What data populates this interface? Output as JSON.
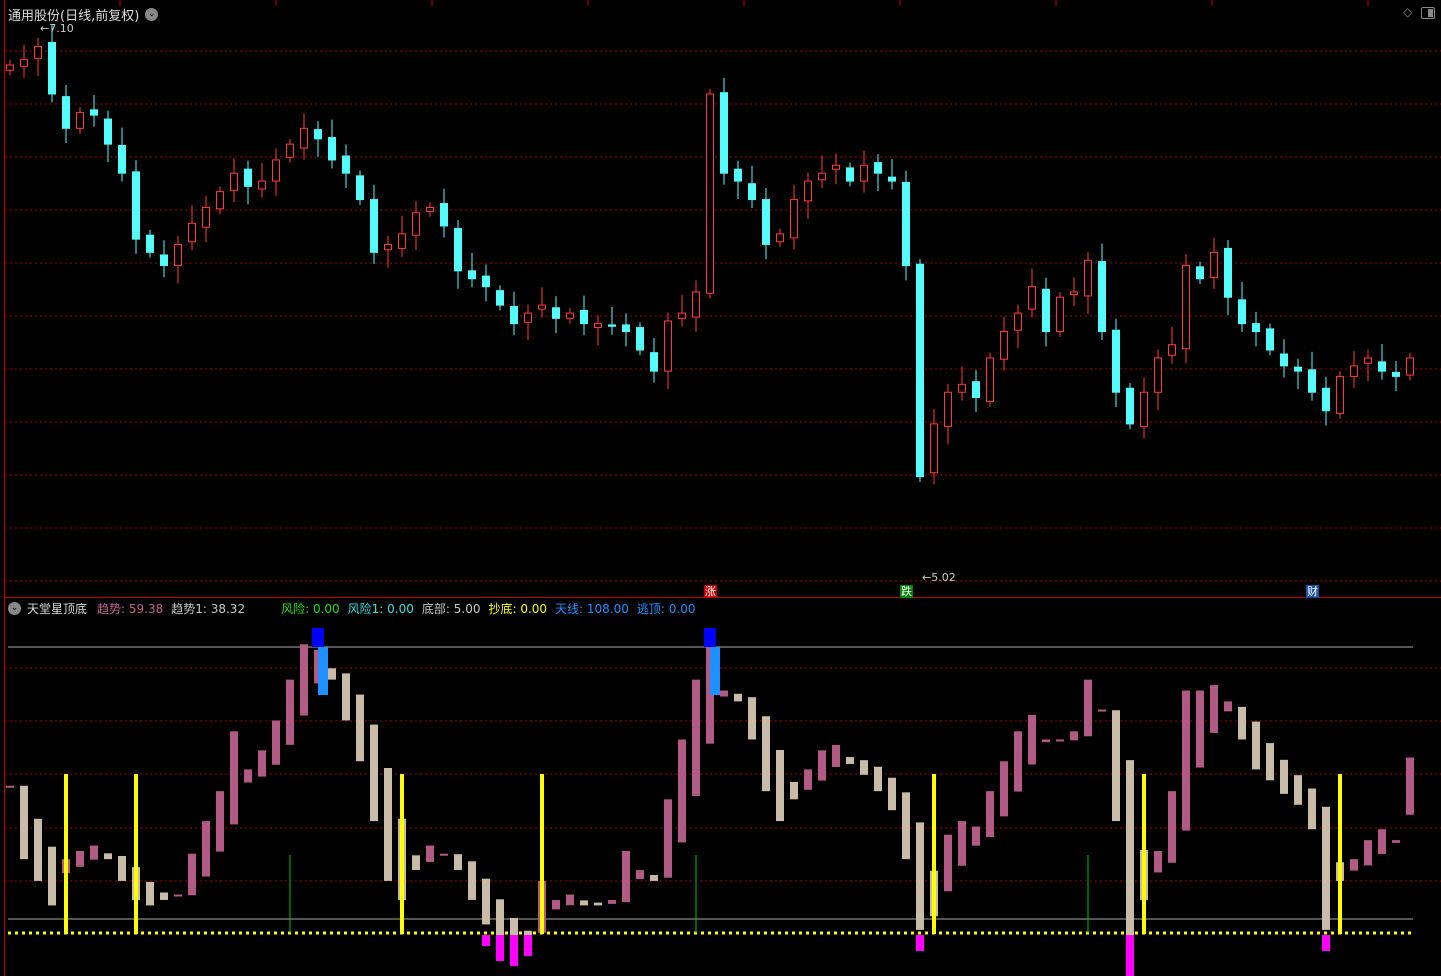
{
  "header": {
    "title": "通用股份(日线,前复权)",
    "high_label": "7.10",
    "low_label": "5.02"
  },
  "price_scale": {
    "max": 7.1,
    "min": 5.02
  },
  "colors": {
    "up": "#ff3b3b",
    "down": "#54fcfc",
    "grid": "#a00000",
    "trend_up": "#b05a84",
    "trend_down": "#c8bca8",
    "buy": "#ffff00",
    "escape": "#1e90ff",
    "top": "#0000ff",
    "risk": "#ff00ff",
    "signal": "#00c000"
  },
  "markers": [
    {
      "label": "涨",
      "index": 50,
      "color": "#c00000"
    },
    {
      "label": "跌",
      "index": 64,
      "color": "#008000"
    },
    {
      "label": "财",
      "index": 93,
      "color": "#2050a0"
    }
  ],
  "closes": [
    6.96,
    6.98,
    7.03,
    6.85,
    6.72,
    6.78,
    6.77,
    6.66,
    6.55,
    6.3,
    6.25,
    6.2,
    6.28,
    6.36,
    6.42,
    6.48,
    6.55,
    6.5,
    6.52,
    6.6,
    6.66,
    6.72,
    6.68,
    6.6,
    6.55,
    6.45,
    6.25,
    6.28,
    6.32,
    6.4,
    6.42,
    6.35,
    6.18,
    6.15,
    6.12,
    6.05,
    5.98,
    6.02,
    6.05,
    6.0,
    6.02,
    5.98,
    5.98,
    5.97,
    5.95,
    5.88,
    5.8,
    5.99,
    6.02,
    6.1,
    6.85,
    6.55,
    6.52,
    6.45,
    6.28,
    6.32,
    6.45,
    6.52,
    6.55,
    6.58,
    6.52,
    6.58,
    6.55,
    6.52,
    6.2,
    5.4,
    5.6,
    5.72,
    5.75,
    5.7,
    5.85,
    5.95,
    6.02,
    6.12,
    5.95,
    6.08,
    6.1,
    6.22,
    5.95,
    5.72,
    5.6,
    5.72,
    5.85,
    5.9,
    6.2,
    6.15,
    6.25,
    6.08,
    5.98,
    5.95,
    5.88,
    5.82,
    5.8,
    5.72,
    5.65,
    5.78,
    5.82,
    5.85,
    5.8,
    5.78,
    5.85
  ],
  "indicator": {
    "name": "天堂星顶底",
    "legend": [
      {
        "label": "趋势: 59.38",
        "color": "#c06890"
      },
      {
        "label": "趋势1: 38.32",
        "color": "#c8c8c8"
      },
      {
        "label": "风险: 0.00",
        "color": "#20e020"
      },
      {
        "label": "风险1: 0.00",
        "color": "#40e0e0"
      },
      {
        "label": "底部: 5.00",
        "color": "#c8c8c8"
      },
      {
        "label": "抄底: 0.00",
        "color": "#ffff00"
      },
      {
        "label": "天线: 108.00",
        "color": "#2090ff"
      },
      {
        "label": "逃顶: 0.00",
        "color": "#2090ff"
      }
    ],
    "upper": 100,
    "lower": 0,
    "floor": -5,
    "trend": [
      49,
      22,
      14,
      5,
      22,
      25,
      27,
      22,
      14,
      7,
      5,
      7,
      9,
      24,
      36,
      47,
      69,
      55,
      62,
      73,
      88,
      101,
      99,
      88,
      73,
      58,
      36,
      14,
      7,
      18,
      27,
      24,
      18,
      7,
      -2,
      -8,
      -10,
      -6,
      14,
      7,
      9,
      5,
      5,
      7,
      25,
      18,
      14,
      44,
      66,
      88,
      103,
      84,
      80,
      66,
      47,
      36,
      44,
      55,
      62,
      64,
      57,
      53,
      47,
      40,
      22,
      -4,
      1,
      31,
      36,
      34,
      47,
      58,
      69,
      75,
      66,
      66,
      69,
      88,
      77,
      36,
      -15,
      7,
      25,
      47,
      84,
      84,
      86,
      80,
      66,
      55,
      51,
      46,
      42,
      33,
      -4,
      14,
      22,
      29,
      33,
      29,
      59.38
    ],
    "buy_signals": [
      4,
      9,
      28,
      38,
      66,
      81,
      95
    ],
    "green_signals": [
      20,
      49,
      77
    ],
    "escape_signals": [
      22,
      50
    ]
  }
}
